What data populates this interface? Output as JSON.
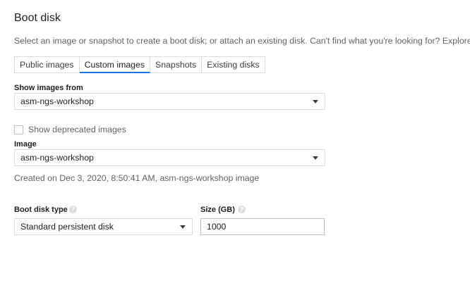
{
  "section": {
    "title": "Boot disk",
    "description": "Select an image or snapshot to create a boot disk; or attach an existing disk. Can't find what you're looking for? Explore hu"
  },
  "tabs": [
    {
      "label": "Public images",
      "active": false
    },
    {
      "label": "Custom images",
      "active": true
    },
    {
      "label": "Snapshots",
      "active": false
    },
    {
      "label": "Existing disks",
      "active": false
    }
  ],
  "show_images_from": {
    "label": "Show images from",
    "value": "asm-ngs-workshop"
  },
  "deprecated": {
    "label": "Show deprecated images",
    "checked": false
  },
  "image": {
    "label": "Image",
    "value": "asm-ngs-workshop",
    "created": "Created on Dec 3, 2020, 8:50:41 AM, asm-ngs-workshop image"
  },
  "boot_disk_type": {
    "label": "Boot disk type",
    "value": "Standard persistent disk",
    "help": "?"
  },
  "size": {
    "label": "Size (GB)",
    "value": "1000",
    "help": "?"
  },
  "colors": {
    "accent": "#1a73e8",
    "border": "#dadce0",
    "muted_text": "#5f6368"
  }
}
